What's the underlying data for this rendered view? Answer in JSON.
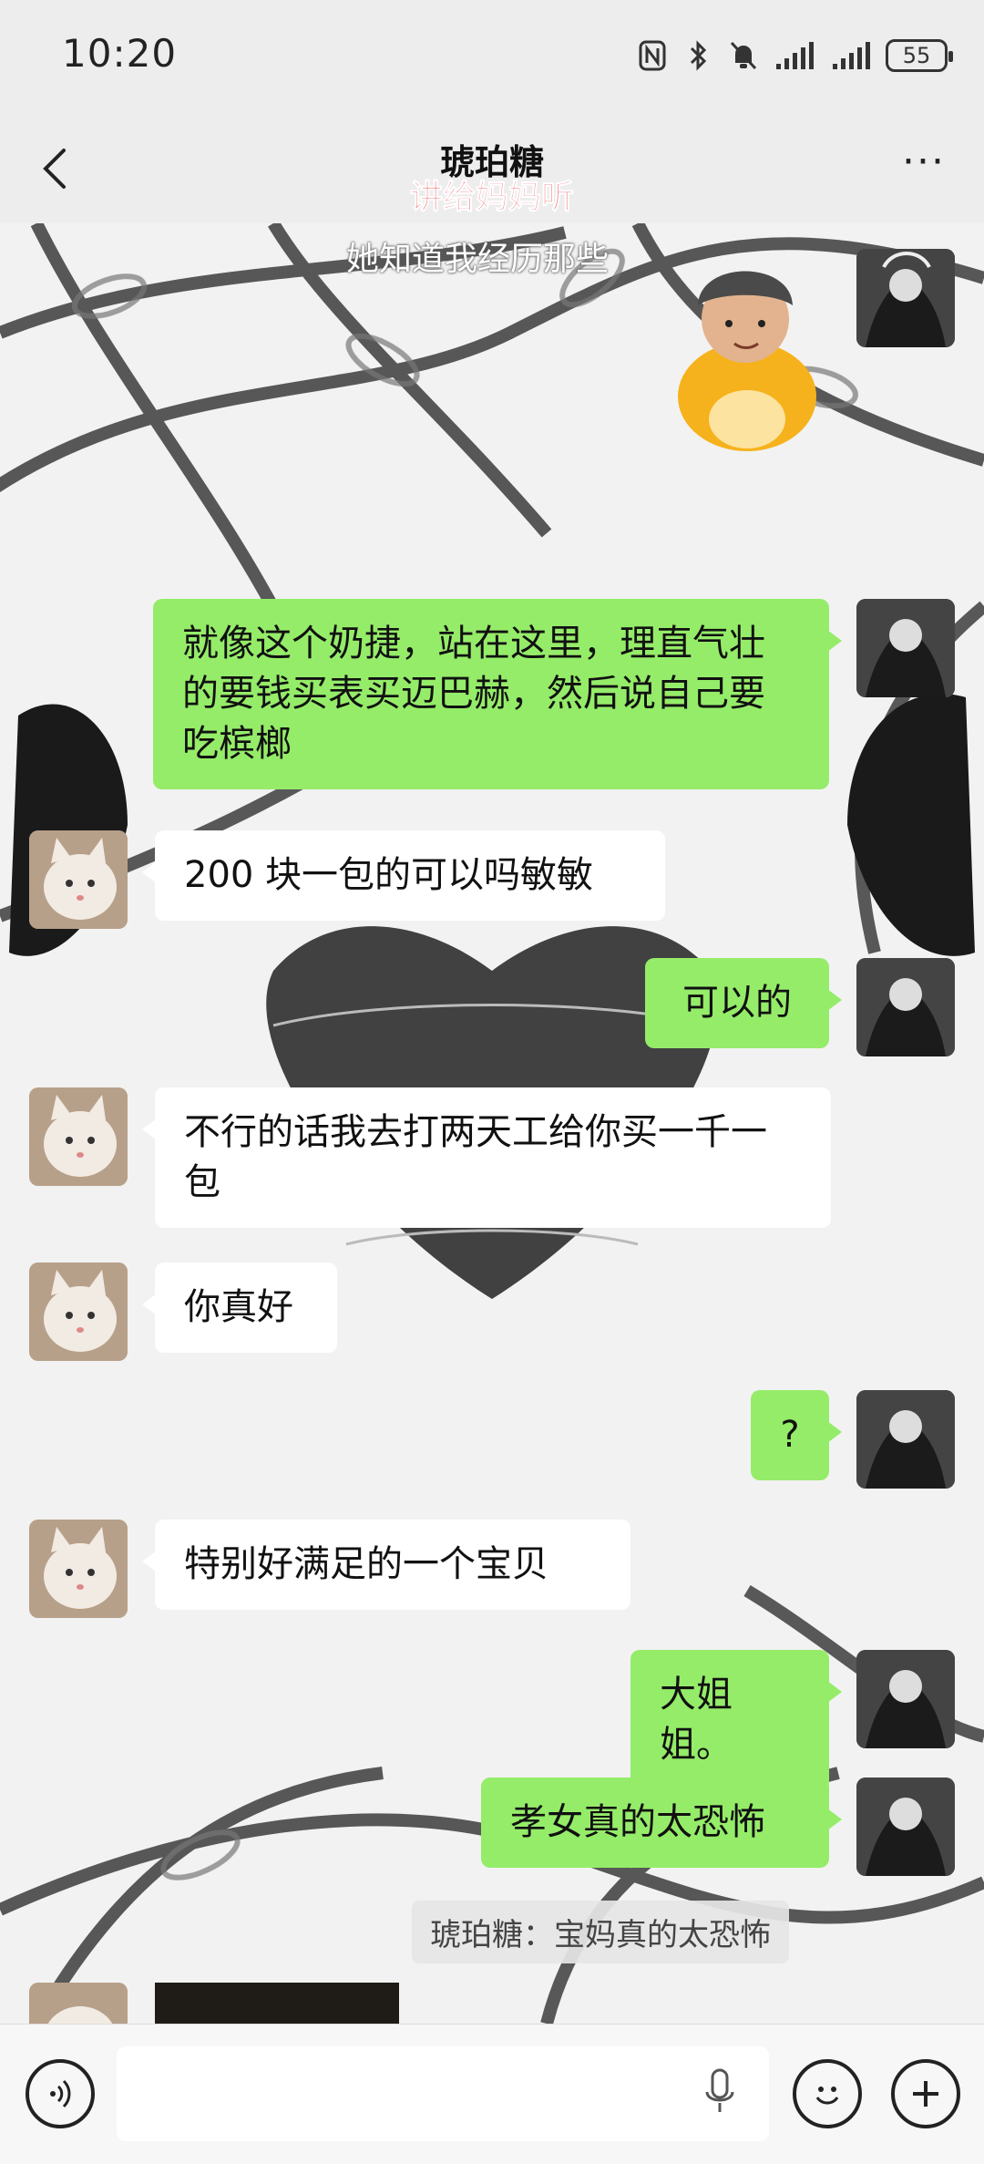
{
  "status_bar": {
    "time": "10:20",
    "battery": "55",
    "icons": [
      "nfc-icon",
      "bluetooth-icon",
      "mute-bell-icon",
      "signal-1-icon",
      "signal-2-icon",
      "battery-icon"
    ]
  },
  "nav": {
    "title": "琥珀糖",
    "back_icon": "chevron-left-icon",
    "more_label": "···"
  },
  "video_overlay": {
    "red_caption": "讲给妈妈听",
    "white_caption": "她知道我经历那些"
  },
  "messages": [
    {
      "side": "self",
      "type": "sticker"
    },
    {
      "side": "self",
      "text": "就像这个奶捷，站在这里，理直气壮的要钱买表买迈巴赫，然后说自己要吃槟榔"
    },
    {
      "side": "other",
      "text": "200 块一包的可以吗敏敏"
    },
    {
      "side": "self",
      "text": "可以的"
    },
    {
      "side": "other",
      "text": "不行的话我去打两天工给你买一千一包"
    },
    {
      "side": "other",
      "text": "你真好"
    },
    {
      "side": "self",
      "text": "?"
    },
    {
      "side": "other",
      "text": "特别好满足的一个宝贝"
    },
    {
      "side": "self",
      "text": "大姐姐。"
    },
    {
      "side": "self",
      "text": "孝女真的太恐怖"
    }
  ],
  "quote": {
    "text": "琥珀糖：宝妈真的太恐怖"
  },
  "colors": {
    "self_bubble": "#95ec69",
    "other_bubble": "#ffffff",
    "overlay_red": "#f06a72"
  }
}
